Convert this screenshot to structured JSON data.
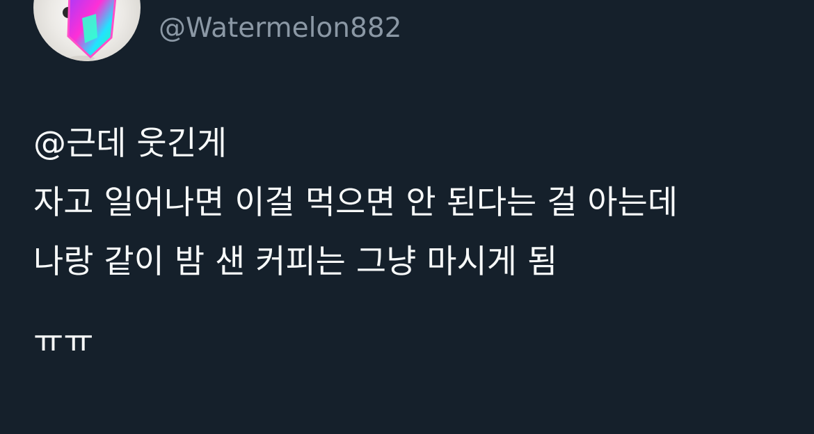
{
  "user": {
    "display_name": "",
    "handle": "@Watermelon882"
  },
  "tweet": {
    "lines": [
      "@근데 웃긴게",
      "자고 일어나면 이걸 먹으면 안 된다는 걸 아는데",
      "나랑 같이 밤 샌 커피는 그냥 마시게 됨",
      "ㅠㅠ"
    ]
  },
  "colors": {
    "background": "#15202b",
    "text_primary": "#f7f9f9",
    "text_secondary": "#8b98a5"
  }
}
